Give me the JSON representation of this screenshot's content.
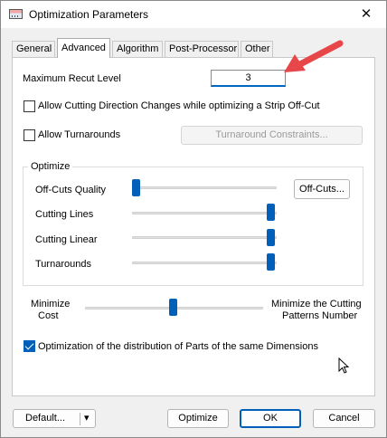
{
  "window": {
    "title": "Optimization Parameters",
    "close_glyph": "✕"
  },
  "tabs": [
    {
      "label": "General"
    },
    {
      "label": "Advanced"
    },
    {
      "label": "Algorithm"
    },
    {
      "label": "Post-Processor"
    },
    {
      "label": "Other"
    }
  ],
  "advanced": {
    "max_recut_label": "Maximum Recut Level",
    "max_recut_value": "3",
    "allow_direction_label": "Allow Cutting Direction Changes while optimizing a Strip Off-Cut",
    "allow_direction_checked": false,
    "allow_turnarounds_label": "Allow Turnarounds",
    "allow_turnarounds_checked": false,
    "turnaround_constraints_label": "Turnaround Constraints...",
    "optimize": {
      "title": "Optimize",
      "sliders": [
        {
          "label": "Off-Cuts Quality",
          "level": 0.0
        },
        {
          "label": "Cutting Lines",
          "level": 1.0
        },
        {
          "label": "Cutting Linear",
          "level": 1.0
        },
        {
          "label": "Turnarounds",
          "level": 1.0
        }
      ],
      "offcuts_button": "Off-Cuts..."
    },
    "balance": {
      "left_label_line1": "Minimize",
      "left_label_line2": "Cost",
      "right_label_line1": "Minimize the Cutting",
      "right_label_line2": "Patterns Number",
      "level": 0.5
    },
    "distribution_label": "Optimization of the distribution of Parts of the same Dimensions",
    "distribution_checked": true
  },
  "buttons": {
    "default": "Default...",
    "default_dropdown": "▾",
    "optimize": "Optimize",
    "ok": "OK",
    "cancel": "Cancel"
  },
  "colors": {
    "accent": "#005fb8",
    "annotation_arrow": "#e8474a"
  },
  "icons": {
    "app": "app-window-icon",
    "arrow": "red-annotation-arrow-icon",
    "cursor": "mouse-pointer-icon"
  }
}
